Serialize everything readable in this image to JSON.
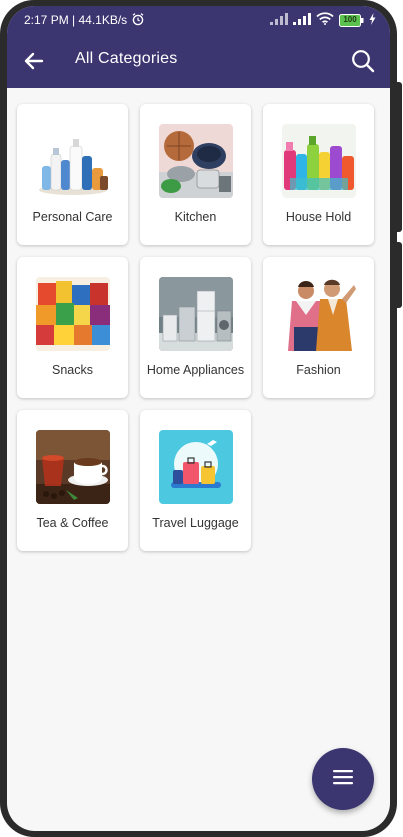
{
  "status_bar": {
    "time_speed": "2:17 PM | 44.1KB/s",
    "battery": "100"
  },
  "app_bar": {
    "title": "All Categories"
  },
  "categories": [
    {
      "label": "Personal Care"
    },
    {
      "label": "Kitchen"
    },
    {
      "label": "House Hold"
    },
    {
      "label": "Snacks"
    },
    {
      "label": "Home Appliances"
    },
    {
      "label": "Fashion"
    },
    {
      "label": "Tea & Coffee"
    },
    {
      "label": "Travel Luggage"
    }
  ],
  "icons": {
    "back": "arrow-left-icon",
    "search": "search-icon",
    "fab": "menu-icon",
    "alarm": "alarm-icon",
    "signal": "signal-icon",
    "wifi": "wifi-icon",
    "battery": "battery-icon",
    "charging": "bolt-icon"
  },
  "colors": {
    "primary": "#3b3570",
    "background": "#f7f7f7",
    "card": "#ffffff",
    "battery": "#5cc24f"
  }
}
